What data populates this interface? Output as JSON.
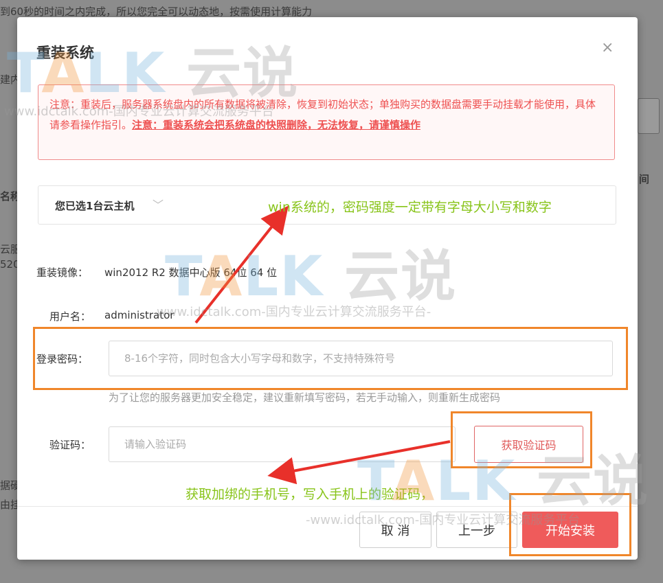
{
  "background": {
    "top_text": "到60秒的时间之内完成，所以您完全可以动态地，按需使用计算能力",
    "left_fragments": [
      "建内",
      "名称",
      "云服",
      "520",
      "据硬",
      "由挂"
    ],
    "right_fragment": "间"
  },
  "dialog": {
    "title": "重装系统",
    "close_symbol": "×",
    "warning": {
      "normal": "注意：重装后，服务器系统盘内的所有数据将被清除，恢复到初始状态；单独购买的数据盘需要手动挂载才能使用，具体请参看操作指引。",
      "emphasis": "注意：重装系统会把系统盘的快照删除，无法恢复，请谨慎操作"
    },
    "host_selector": {
      "label": "您已选1台云主机",
      "chevron": "﹀"
    },
    "image": {
      "label": "重装镜像：",
      "value": "win2012 R2 数据中心版 64位 64 位"
    },
    "username": {
      "label": "用户名：",
      "value": "administrator"
    },
    "password": {
      "label": "登录密码：",
      "placeholder": "8-16个字符，同时包含大小写字母和数字，不支持特殊符号",
      "hint": "为了让您的服务器更加安全稳定，建议重新填写密码，若无手动输入，则重新生成密码"
    },
    "captcha": {
      "label": "验证码：",
      "placeholder": "请输入验证码",
      "button": "获取验证码"
    },
    "buttons": {
      "cancel": "取 消",
      "prev": "上一步",
      "start": "开始安装"
    }
  },
  "annotations": {
    "password_note": "win系统的，密码强度一定带有字母大小写和数字",
    "captcha_note": "获取加绑的手机号，写入手机上的验证码，"
  },
  "watermark": {
    "logo_t": "T",
    "logo_a": "A",
    "logo_lk": "LK",
    "logo_cn": "云说",
    "url": "www.idctalk.com-国内专业云计算交流服务平台-",
    "url_short": "www.idctalk.com-国内专业云计算交流服务平台",
    "url_dash": "-www.idctalk.com-国内专业云计算交流服务平台"
  },
  "colors": {
    "accent": "#ef5b5b",
    "highlight": "#f0862a",
    "annotation": "#88c41a",
    "arrow": "#e8302a"
  }
}
